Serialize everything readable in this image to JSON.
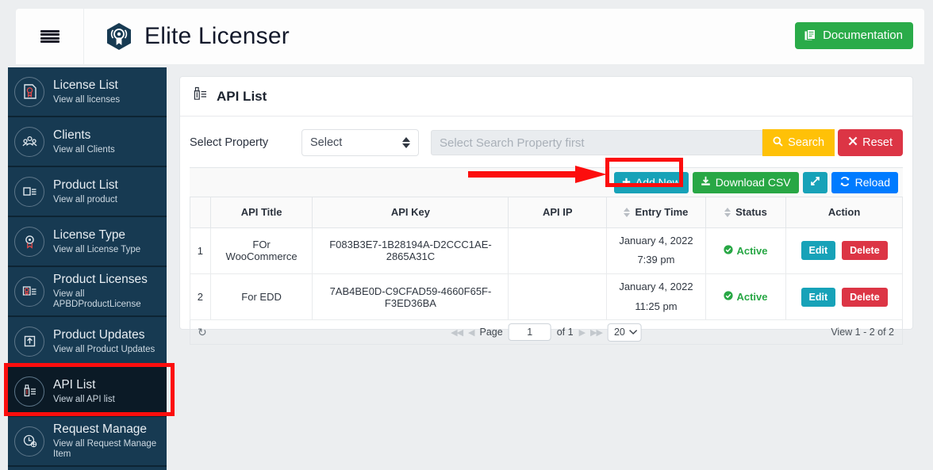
{
  "topbar": {
    "menu_icon": "hamburger-icon",
    "brand_icon": "license-badge-logo",
    "brand_title": "Elite Licenser",
    "documentation_label": "Documentation",
    "documentation_icon": "documentation-icon",
    "documentation_color": "#2aab49"
  },
  "sidebar": {
    "background_color": "#173a52",
    "active_color": "#0b1a26",
    "items": [
      {
        "title": "License List",
        "sub": "View all licenses",
        "icon": "certificate-icon",
        "active": false
      },
      {
        "title": "Clients",
        "sub": "View all Clients",
        "icon": "users-group-icon",
        "active": false
      },
      {
        "title": "Product List",
        "sub": "View all product",
        "icon": "product-list-icon",
        "active": false
      },
      {
        "title": "License Type",
        "sub": "View all License Type",
        "icon": "award-badge-icon",
        "active": false
      },
      {
        "title": "Product Licenses",
        "sub": "View all APBDProductLicense",
        "icon": "product-license-icon",
        "active": false
      },
      {
        "title": "Product Updates",
        "sub": "View all Product Updates",
        "icon": "upload-arrow-icon",
        "active": false
      },
      {
        "title": "API List",
        "sub": "View all API list",
        "icon": "api-key-icon",
        "active": true
      },
      {
        "title": "Request Manage",
        "sub": "View all Request Manage Item",
        "icon": "request-clock-icon",
        "active": false
      }
    ]
  },
  "panel": {
    "title": "API List",
    "title_icon": "api-key-icon",
    "filter": {
      "label": "Select Property",
      "select_value": "Select",
      "search_placeholder": "Select Search Property first",
      "search_value": "",
      "search_button": "Search",
      "search_icon": "magnifier-icon",
      "reset_button": "Reset",
      "reset_icon": "x-icon"
    },
    "toolbar": {
      "add_new": "Add New",
      "add_new_icon": "plus-icon",
      "download_csv": "Download CSV",
      "download_csv_icon": "download-icon",
      "expand_icon": "expand-arrows-icon",
      "reload": "Reload",
      "reload_icon": "refresh-icon"
    },
    "table": {
      "columns": [
        "",
        "API Title",
        "API Key",
        "API IP",
        "Entry Time",
        "Status",
        "Action"
      ],
      "sortable": [
        false,
        false,
        false,
        false,
        true,
        true,
        false
      ],
      "rows": [
        {
          "index": "1",
          "api_title": "FOr WooCommerce",
          "api_key": "F083B3E7-1B28194A-D2CCC1AE-2865A31C",
          "api_ip": "",
          "entry_time": "January 4, 2022 7:39 pm",
          "status": "Active",
          "status_icon": "check-circle-icon",
          "edit_label": "Edit",
          "delete_label": "Delete"
        },
        {
          "index": "2",
          "api_title": "For EDD",
          "api_key": "7AB4BE0D-C9CFAD59-4660F65F-F3ED36BA",
          "api_ip": "",
          "entry_time": "January 4, 2022 11:25 pm",
          "status": "Active",
          "status_icon": "check-circle-icon",
          "edit_label": "Edit",
          "delete_label": "Delete"
        }
      ]
    },
    "pagination": {
      "refresh_icon": "refresh-small-icon",
      "first_icon": "first-page-icon",
      "prev_icon": "prev-page-icon",
      "page_label": "Page",
      "page_value": "1",
      "of_label": "of 1",
      "next_icon": "next-page-icon",
      "last_icon": "last-page-icon",
      "page_size": "20",
      "view_text": "View 1 - 2 of 2"
    }
  },
  "annotations": {
    "arrow_color": "#fc0d0d",
    "highlight_color": "#fc0d0d",
    "arrow_points_to": "Add New",
    "highlight_targets": [
      "Add New",
      "API List"
    ]
  }
}
